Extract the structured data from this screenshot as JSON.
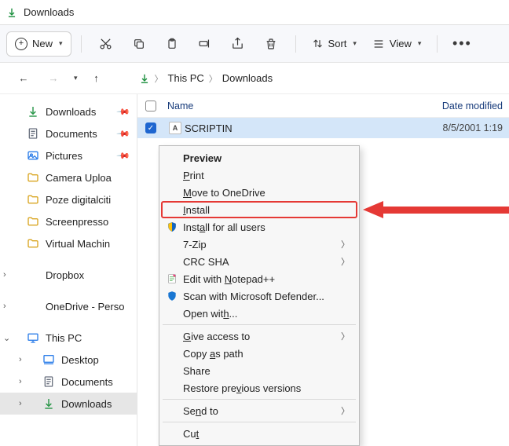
{
  "window": {
    "title": "Downloads"
  },
  "toolbar": {
    "new_label": "New",
    "sort_label": "Sort",
    "view_label": "View"
  },
  "address": {
    "root": "This PC",
    "folder": "Downloads"
  },
  "sidebar": {
    "items": [
      {
        "label": "Downloads",
        "icon": "download",
        "pinned": true
      },
      {
        "label": "Documents",
        "icon": "document",
        "pinned": true
      },
      {
        "label": "Pictures",
        "icon": "pictures",
        "pinned": true
      },
      {
        "label": "Camera Uploa",
        "icon": "folder"
      },
      {
        "label": "Poze digitalciti",
        "icon": "folder"
      },
      {
        "label": "Screenpresso",
        "icon": "folder"
      },
      {
        "label": "Virtual Machin",
        "icon": "folder"
      }
    ],
    "groups": [
      {
        "label": "Dropbox",
        "icon": "dropbox",
        "chev": "right"
      },
      {
        "label": "OneDrive - Perso",
        "icon": "onedrive",
        "chev": "right"
      },
      {
        "label": "This PC",
        "icon": "pc",
        "chev": "down",
        "children": [
          {
            "label": "Desktop",
            "icon": "desktop",
            "chev": "right"
          },
          {
            "label": "Documents",
            "icon": "document",
            "chev": "right"
          },
          {
            "label": "Downloads",
            "icon": "download",
            "chev": "right",
            "selected": true
          }
        ]
      }
    ]
  },
  "columns": {
    "name": "Name",
    "date": "Date modified"
  },
  "files": [
    {
      "name": "SCRIPTIN",
      "date": "8/5/2001 1:19",
      "selected": true
    }
  ],
  "context_menu": [
    {
      "label": "Preview",
      "bold": true,
      "ul": ""
    },
    {
      "label": "Print",
      "ul": "P"
    },
    {
      "label": "Move to OneDrive",
      "ul": "M"
    },
    {
      "label": "Install",
      "ul": "I",
      "highlight": true
    },
    {
      "label": "Install for all users",
      "ul": "a",
      "icon": "shield"
    },
    {
      "label": "7-Zip",
      "submenu": true
    },
    {
      "label": "CRC SHA",
      "submenu": true
    },
    {
      "label": "Edit with Notepad++",
      "ul": "N",
      "icon": "notepad"
    },
    {
      "label": "Scan with Microsoft Defender...",
      "icon": "defender"
    },
    {
      "label": "Open with...",
      "ul": "h"
    },
    {
      "sep": true
    },
    {
      "label": "Give access to",
      "ul": "G",
      "submenu": true
    },
    {
      "label": "Copy as path",
      "ul": "a"
    },
    {
      "label": "Share",
      "ul": ""
    },
    {
      "label": "Restore previous versions",
      "ul": "v"
    },
    {
      "sep": true
    },
    {
      "label": "Send to",
      "ul": "n",
      "submenu": true
    },
    {
      "sep": true
    },
    {
      "label": "Cut",
      "ul": "t"
    }
  ]
}
